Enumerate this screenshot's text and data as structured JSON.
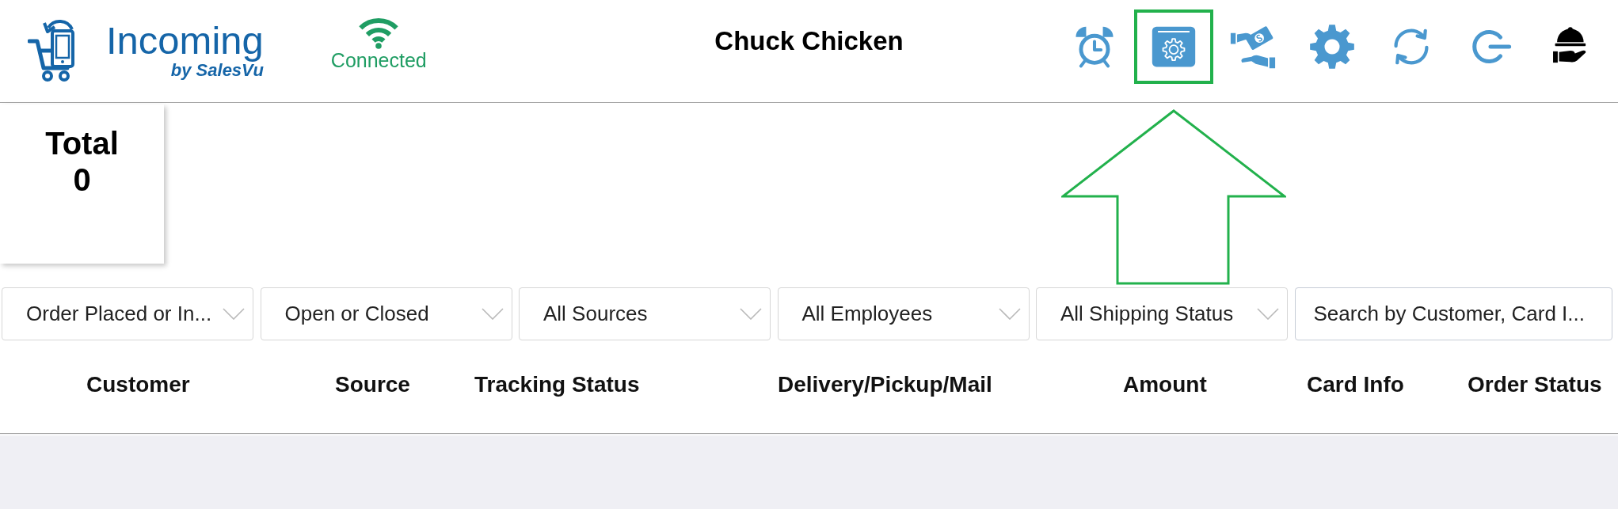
{
  "header": {
    "logo": {
      "title": "Incoming",
      "subtitle": "by SalesVu"
    },
    "connection": {
      "label": "Connected"
    },
    "title": "Chuck Chicken",
    "toolbar": [
      {
        "highlighted": false
      },
      {
        "highlighted": true
      },
      {
        "highlighted": false
      },
      {
        "highlighted": false
      },
      {
        "highlighted": false
      },
      {
        "highlighted": false
      },
      {
        "highlighted": false
      }
    ]
  },
  "summary": {
    "label": "Total",
    "value": "0"
  },
  "filters": [
    {
      "kind": "dropdown",
      "value": "Order Placed or In..."
    },
    {
      "kind": "dropdown",
      "value": "Open or Closed"
    },
    {
      "kind": "dropdown",
      "value": "All Sources"
    },
    {
      "kind": "dropdown",
      "value": "All Employees"
    },
    {
      "kind": "dropdown",
      "value": "All Shipping Status"
    },
    {
      "kind": "search",
      "placeholder": "Search by Customer, Card I..."
    }
  ],
  "table": {
    "columns": [
      "Customer",
      "Source",
      "Tracking Status",
      "Delivery/Pickup/Mail",
      "Amount",
      "Card Info",
      "Order Status"
    ]
  }
}
